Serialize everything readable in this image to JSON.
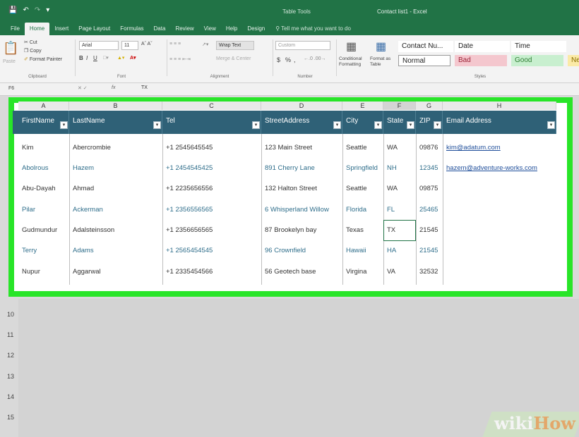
{
  "window": {
    "table_tools": "Table Tools",
    "title": "Contact list1 - Excel"
  },
  "ribbon_tabs": [
    "File",
    "Home",
    "Insert",
    "Page Layout",
    "Formulas",
    "Data",
    "Review",
    "View",
    "Help",
    "Design"
  ],
  "tell_me": "Tell me what you want to do",
  "clipboard": {
    "cut": "Cut",
    "copy": "Copy",
    "format_painter": "Format Painter",
    "paste": "Paste",
    "group": "Clipboard"
  },
  "font": {
    "name": "Arial",
    "size": "11",
    "group": "Font",
    "bold": "B",
    "italic": "I",
    "underline": "U"
  },
  "alignment": {
    "wrap_text": "Wrap Text",
    "merge": "Merge & Center",
    "group": "Alignment"
  },
  "number": {
    "format": "Custom",
    "currency": "$",
    "percent": "%",
    "comma": ",",
    "group": "Number"
  },
  "styles": {
    "conditional": "Conditional Formatting",
    "format_as_table": "Format as Table",
    "group": "Styles",
    "cells": [
      {
        "label": "Contact Nu...",
        "color": "#ffffff",
        "text": "#222222"
      },
      {
        "label": "Date",
        "color": "#ffffff",
        "text": "#222222"
      },
      {
        "label": "Time",
        "color": "#ffffff",
        "text": "#222222"
      },
      {
        "label": "Normal",
        "color": "#ffffff",
        "text": "#222222"
      },
      {
        "label": "Bad",
        "color": "#f4c7ce",
        "text": "#9c2336"
      },
      {
        "label": "Good",
        "color": "#c8efcf",
        "text": "#2e7d32"
      },
      {
        "label": "Ne",
        "color": "#fbeaa7",
        "text": "#8a6d00"
      }
    ]
  },
  "formula_bar": {
    "name_box": "F6",
    "fx": "fx",
    "content": "TX"
  },
  "columns": [
    "A",
    "B",
    "C",
    "D",
    "E",
    "F",
    "G",
    "H"
  ],
  "row_numbers": [
    "10",
    "11",
    "12",
    "13",
    "14",
    "15"
  ],
  "table": {
    "headers": [
      "FirstName",
      "LastName",
      "Tel",
      "StreetAddress",
      "City",
      "State",
      "ZIP",
      "Email Address"
    ],
    "rows": [
      [
        "Kim",
        "Abercrombie",
        "+1 2545645545",
        "123 Main Street",
        "Seattle",
        "WA",
        "09876",
        "kim@adatum.com"
      ],
      [
        "Abolrous",
        "Hazem",
        "+1 2454545425",
        "891 Cherry Lane",
        "Springfield",
        "NH",
        "12345",
        "hazem@adventure-works.com"
      ],
      [
        "Abu-Dayah",
        "Ahmad",
        "+1 2235656556",
        "132 Halton Street",
        "Seattle",
        "WA",
        "09875",
        ""
      ],
      [
        "Pilar",
        "Ackerman",
        "+1 2356556565",
        "6 Whisperland Willow",
        "Florida",
        "FL",
        "25465",
        ""
      ],
      [
        "Gudmundur",
        "Adalsteinsson",
        "+1 2356656565",
        "87 Brookelyn bay",
        "Texas",
        "TX",
        "21545",
        ""
      ],
      [
        "Terry",
        "Adams",
        "+1 2565454545",
        "96 Crownfield",
        "Hawaii",
        "HA",
        "21545",
        ""
      ],
      [
        "Nupur",
        "Aggarwal",
        "+1 2335454566",
        "56 Geotech base",
        "Virgina",
        "VA",
        "32532",
        ""
      ]
    ]
  },
  "watermark": {
    "part1": "wiki",
    "part2": "How"
  }
}
